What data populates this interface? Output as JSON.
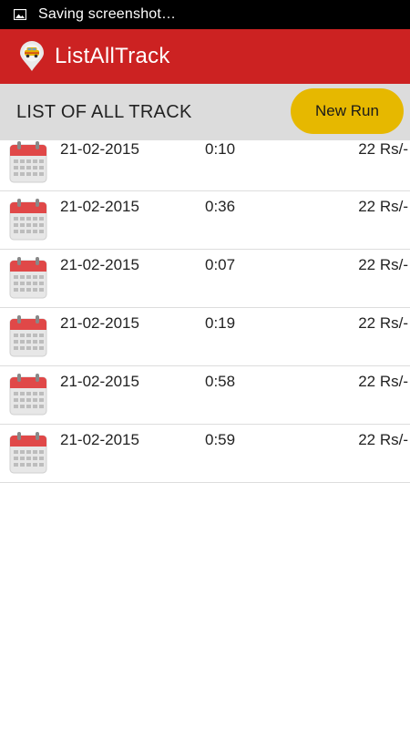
{
  "status_bar": {
    "icon": "image-icon",
    "text": "Saving screenshot…"
  },
  "app_bar": {
    "icon": "location-pin-car-icon",
    "title": "ListAllTrack",
    "color": "#cc2222"
  },
  "header": {
    "title": "LIST OF ALL TRACK",
    "new_run_label": "New Run",
    "button_color": "#e6b800"
  },
  "tracks": {
    "icon": "calendar-icon",
    "items": [
      {
        "date": "21-02-2015",
        "time": "0:10",
        "price": "22 Rs/-"
      },
      {
        "date": "21-02-2015",
        "time": "0:36",
        "price": "22 Rs/-"
      },
      {
        "date": "21-02-2015",
        "time": "0:07",
        "price": "22 Rs/-"
      },
      {
        "date": "21-02-2015",
        "time": "0:19",
        "price": "22 Rs/-"
      },
      {
        "date": "21-02-2015",
        "time": "0:58",
        "price": "22 Rs/-"
      },
      {
        "date": "21-02-2015",
        "time": "0:59",
        "price": "22 Rs/-"
      }
    ]
  }
}
